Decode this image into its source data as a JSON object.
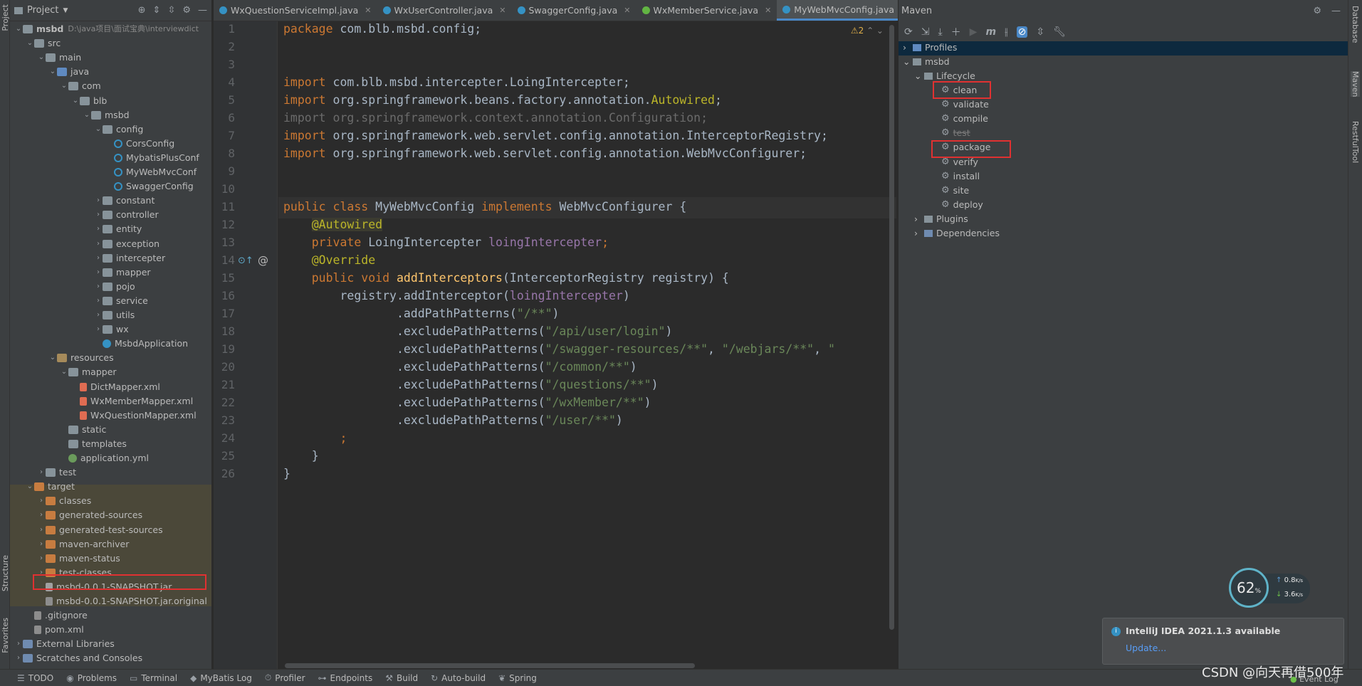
{
  "project": {
    "title": "Project",
    "tree": [
      {
        "label": "msbd",
        "extra": "D:\\java项目\\面试宝典\\interviewdict",
        "depth": 0,
        "icon": "folder",
        "arrow": "down",
        "bold": true
      },
      {
        "label": "src",
        "depth": 1,
        "icon": "folder",
        "arrow": "down"
      },
      {
        "label": "main",
        "depth": 2,
        "icon": "folder",
        "arrow": "down"
      },
      {
        "label": "java",
        "depth": 3,
        "icon": "folder-src",
        "arrow": "down"
      },
      {
        "label": "com",
        "depth": 4,
        "icon": "folder",
        "arrow": "down"
      },
      {
        "label": "blb",
        "depth": 5,
        "icon": "folder",
        "arrow": "down"
      },
      {
        "label": "msbd",
        "depth": 6,
        "icon": "folder",
        "arrow": "down"
      },
      {
        "label": "config",
        "depth": 7,
        "icon": "folder",
        "arrow": "down"
      },
      {
        "label": "CorsConfig",
        "depth": 8,
        "icon": "class",
        "arrow": ""
      },
      {
        "label": "MybatisPlusConf",
        "depth": 8,
        "icon": "class",
        "arrow": ""
      },
      {
        "label": "MyWebMvcConf",
        "depth": 8,
        "icon": "class",
        "arrow": ""
      },
      {
        "label": "SwaggerConfig",
        "depth": 8,
        "icon": "class",
        "arrow": ""
      },
      {
        "label": "constant",
        "depth": 7,
        "icon": "folder",
        "arrow": "right"
      },
      {
        "label": "controller",
        "depth": 7,
        "icon": "folder",
        "arrow": "right"
      },
      {
        "label": "entity",
        "depth": 7,
        "icon": "folder",
        "arrow": "right"
      },
      {
        "label": "exception",
        "depth": 7,
        "icon": "folder",
        "arrow": "right"
      },
      {
        "label": "intercepter",
        "depth": 7,
        "icon": "folder",
        "arrow": "right"
      },
      {
        "label": "mapper",
        "depth": 7,
        "icon": "folder",
        "arrow": "right"
      },
      {
        "label": "pojo",
        "depth": 7,
        "icon": "folder",
        "arrow": "right"
      },
      {
        "label": "service",
        "depth": 7,
        "icon": "folder",
        "arrow": "right"
      },
      {
        "label": "utils",
        "depth": 7,
        "icon": "folder",
        "arrow": "right"
      },
      {
        "label": "wx",
        "depth": 7,
        "icon": "folder",
        "arrow": "right"
      },
      {
        "label": "MsbdApplication",
        "depth": 7,
        "icon": "app",
        "arrow": ""
      },
      {
        "label": "resources",
        "depth": 3,
        "icon": "folder-res",
        "arrow": "down"
      },
      {
        "label": "mapper",
        "depth": 4,
        "icon": "folder",
        "arrow": "down"
      },
      {
        "label": "DictMapper.xml",
        "depth": 5,
        "icon": "xml",
        "arrow": ""
      },
      {
        "label": "WxMemberMapper.xml",
        "depth": 5,
        "icon": "xml",
        "arrow": ""
      },
      {
        "label": "WxQuestionMapper.xml",
        "depth": 5,
        "icon": "xml",
        "arrow": ""
      },
      {
        "label": "static",
        "depth": 4,
        "icon": "folder",
        "arrow": ""
      },
      {
        "label": "templates",
        "depth": 4,
        "icon": "folder",
        "arrow": ""
      },
      {
        "label": "application.yml",
        "depth": 4,
        "icon": "yml",
        "arrow": ""
      },
      {
        "label": "test",
        "depth": 2,
        "icon": "folder",
        "arrow": "right"
      },
      {
        "label": "target",
        "depth": 1,
        "icon": "folder-target",
        "arrow": "down"
      },
      {
        "label": "classes",
        "depth": 2,
        "icon": "folder-target",
        "arrow": "right"
      },
      {
        "label": "generated-sources",
        "depth": 2,
        "icon": "folder-target",
        "arrow": "right"
      },
      {
        "label": "generated-test-sources",
        "depth": 2,
        "icon": "folder-target",
        "arrow": "right"
      },
      {
        "label": "maven-archiver",
        "depth": 2,
        "icon": "folder-target",
        "arrow": "right"
      },
      {
        "label": "maven-status",
        "depth": 2,
        "icon": "folder-target",
        "arrow": "right"
      },
      {
        "label": "test-classes",
        "depth": 2,
        "icon": "folder-target",
        "arrow": "right"
      },
      {
        "label": "msbd-0.0.1-SNAPSHOT.jar",
        "depth": 2,
        "icon": "jar",
        "arrow": ""
      },
      {
        "label": "msbd-0.0.1-SNAPSHOT.jar.original",
        "depth": 2,
        "icon": "file",
        "arrow": ""
      },
      {
        "label": ".gitignore",
        "depth": 1,
        "icon": "file",
        "arrow": ""
      },
      {
        "label": "pom.xml",
        "depth": 1,
        "icon": "file",
        "arrow": ""
      },
      {
        "label": "External Libraries",
        "depth": 0,
        "icon": "lib",
        "arrow": "right"
      },
      {
        "label": "Scratches and Consoles",
        "depth": 0,
        "icon": "lib",
        "arrow": "right"
      }
    ]
  },
  "left_strip": {
    "project": "Project",
    "structure": "Structure",
    "favorites": "Favorites"
  },
  "tabs": [
    {
      "label": "WxQuestionServiceImpl.java",
      "type": "class",
      "active": false
    },
    {
      "label": "WxUserController.java",
      "type": "class",
      "active": false
    },
    {
      "label": "SwaggerConfig.java",
      "type": "class",
      "active": false
    },
    {
      "label": "WxMemberService.java",
      "type": "interface",
      "active": false
    },
    {
      "label": "MyWebMvcConfig.java",
      "type": "class",
      "active": true
    }
  ],
  "editor": {
    "warning_count": "2",
    "line_numbers": [
      "1",
      "2",
      "3",
      "4",
      "5",
      "6",
      "7",
      "8",
      "9",
      "10",
      "11",
      "12",
      "13",
      "14",
      "15",
      "16",
      "17",
      "18",
      "19",
      "20",
      "21",
      "22",
      "23",
      "24",
      "25",
      "26"
    ]
  },
  "maven": {
    "title": "Maven",
    "profiles": "Profiles",
    "project": "msbd",
    "lifecycle": "Lifecycle",
    "goals": [
      "clean",
      "validate",
      "compile",
      "test",
      "package",
      "verify",
      "install",
      "site",
      "deploy"
    ],
    "plugins": "Plugins",
    "dependencies": "Dependencies"
  },
  "right_strip": {
    "database": "Database",
    "maven": "Maven",
    "restful": "RestfulTool"
  },
  "bottom_bar": [
    {
      "icon": "list-icon",
      "label": "TODO"
    },
    {
      "icon": "problems-icon",
      "label": "Problems"
    },
    {
      "icon": "terminal-icon",
      "label": "Terminal"
    },
    {
      "icon": "mybatis-icon",
      "label": "MyBatis Log"
    },
    {
      "icon": "profiler-icon",
      "label": "Profiler"
    },
    {
      "icon": "endpoints-icon",
      "label": "Endpoints"
    },
    {
      "icon": "build-icon",
      "label": "Build"
    },
    {
      "icon": "autobuild-icon",
      "label": "Auto-build"
    },
    {
      "icon": "spring-icon",
      "label": "Spring"
    }
  ],
  "notification": {
    "title": "IntelliJ IDEA 2021.1.3 available",
    "link": "Update..."
  },
  "speed_widget": {
    "percent": "62",
    "percent_unit": "%",
    "up": "0.8",
    "down": "3.6",
    "unit": "K/s"
  },
  "event_log": "Event Log",
  "watermark": "CSDN @向天再借500年"
}
